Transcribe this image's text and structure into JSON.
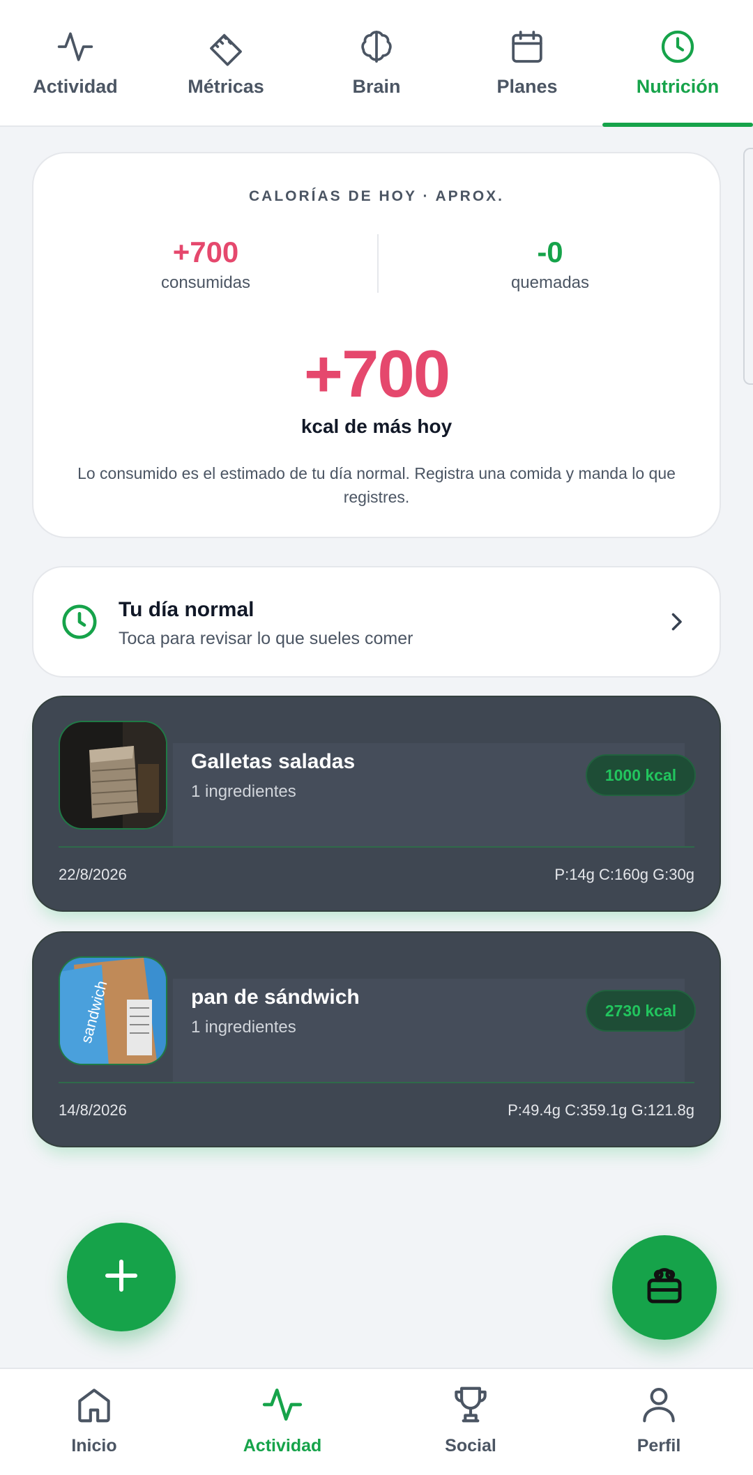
{
  "top_tabs": [
    {
      "label": "Actividad",
      "icon": "activity-icon"
    },
    {
      "label": "Métricas",
      "icon": "ruler-icon"
    },
    {
      "label": "Brain",
      "icon": "brain-icon"
    },
    {
      "label": "Planes",
      "icon": "calendar-icon"
    },
    {
      "label": "Nutrición",
      "icon": "clock-icon",
      "active": true
    }
  ],
  "calories": {
    "title": "CALORÍAS DE HOY · APROX.",
    "consumed_value": "+700",
    "consumed_label": "consumidas",
    "burned_value": "-0",
    "burned_label": "quemadas",
    "net_value": "+700",
    "net_label": "kcal de más hoy",
    "note": "Lo consumido es el estimado de tu día normal. Registra una comida y manda lo que registres."
  },
  "normal_day": {
    "title": "Tu día normal",
    "subtitle": "Toca para revisar lo que sueles comer"
  },
  "meals": [
    {
      "name": "Galletas saladas",
      "ingredients": "1 ingredientes",
      "kcal": "1000 kcal",
      "date": "22/8/2026",
      "macros": "P:14g C:160g G:30g"
    },
    {
      "name": "pan de sándwich",
      "ingredients": "1 ingredientes",
      "kcal": "2730 kcal",
      "date": "14/8/2026",
      "macros": "P:49.4g C:359.1g G:121.8g"
    }
  ],
  "bottom_nav": [
    {
      "label": "Inicio",
      "icon": "home-icon"
    },
    {
      "label": "Actividad",
      "icon": "activity-icon",
      "active": true
    },
    {
      "label": "Social",
      "icon": "trophy-icon"
    },
    {
      "label": "Perfil",
      "icon": "user-icon"
    }
  ],
  "colors": {
    "accent": "#16a34a",
    "negative": "#e5486d",
    "card_dark": "#3f4752"
  }
}
